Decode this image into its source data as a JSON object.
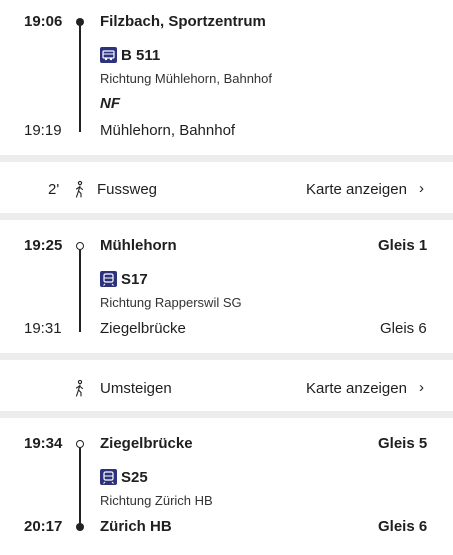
{
  "leg1": {
    "dep_time": "19:06",
    "dep_stop": "Filzbach, Sportzentrum",
    "line": "B 511",
    "direction": "Richtung Mühlehorn, Bahnhof",
    "note": "NF",
    "arr_time": "19:19",
    "arr_stop": "Mühlehorn, Bahnhof"
  },
  "walk": {
    "duration": "2'",
    "label": "Fussweg",
    "map_link": "Karte anzeigen",
    "chevron": "›"
  },
  "leg2": {
    "dep_time": "19:25",
    "dep_stop": "Mühlehorn",
    "dep_platform": "Gleis 1",
    "line": "S17",
    "direction": "Richtung Rapperswil SG",
    "arr_time": "19:31",
    "arr_stop": "Ziegelbrücke",
    "arr_platform": "Gleis 6"
  },
  "transfer": {
    "label": "Umsteigen",
    "map_link": "Karte anzeigen",
    "chevron": "›"
  },
  "leg3": {
    "dep_time": "19:34",
    "dep_stop": "Ziegelbrücke",
    "dep_platform": "Gleis 5",
    "line": "S25",
    "direction": "Richtung Zürich HB",
    "arr_time": "20:17",
    "arr_stop": "Zürich HB",
    "arr_platform": "Gleis 6"
  },
  "icons": {
    "bus": "bus-icon",
    "train": "train-icon",
    "walk": "walking-person-icon",
    "chevron": "chevron-right-icon"
  },
  "colors": {
    "badge": "#2d327d",
    "separator": "#ededed"
  }
}
